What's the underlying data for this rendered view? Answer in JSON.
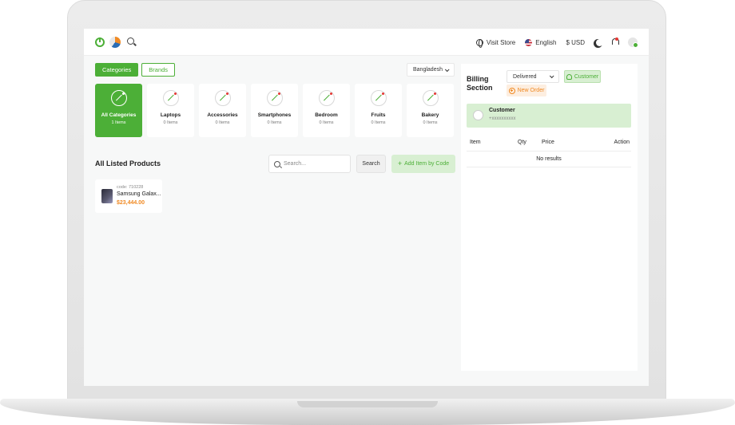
{
  "topbar": {
    "visit_store": "Visit Store",
    "language": "English",
    "currency": "$ USD"
  },
  "tabs": [
    {
      "label": "Categories",
      "active": true
    },
    {
      "label": "Brands",
      "active": false
    }
  ],
  "country": "Bangladesh",
  "categories": [
    {
      "name": "All Categories",
      "count": "1 Items",
      "active": true
    },
    {
      "name": "Laptops",
      "count": "0 Items"
    },
    {
      "name": "Accessories",
      "count": "0 Items"
    },
    {
      "name": "Smartphones",
      "count": "0 Items"
    },
    {
      "name": "Bedroom",
      "count": "0 Items"
    },
    {
      "name": "Fruits",
      "count": "0 Items"
    },
    {
      "name": "Bakery",
      "count": "0 Items"
    }
  ],
  "products_section": {
    "title": "All Listed Products",
    "search_placeholder": "Search...",
    "search_button": "Search",
    "add_button": "Add Item by Code"
  },
  "products": [
    {
      "code": "code: 710228",
      "name": "Samsung Galax...",
      "price": "$23,444.00"
    }
  ],
  "billing": {
    "title": "Billing Section",
    "status": "Delivered",
    "customer_button": "Customer",
    "new_order_button": "New Order",
    "customer_name": "Customer",
    "customer_phone": "+xxxxxxxxxx",
    "columns": [
      "Item",
      "Qty",
      "Price",
      "Action"
    ],
    "empty_text": "No results"
  },
  "colors": {
    "accent": "#4caf37",
    "price": "#f08a24"
  }
}
